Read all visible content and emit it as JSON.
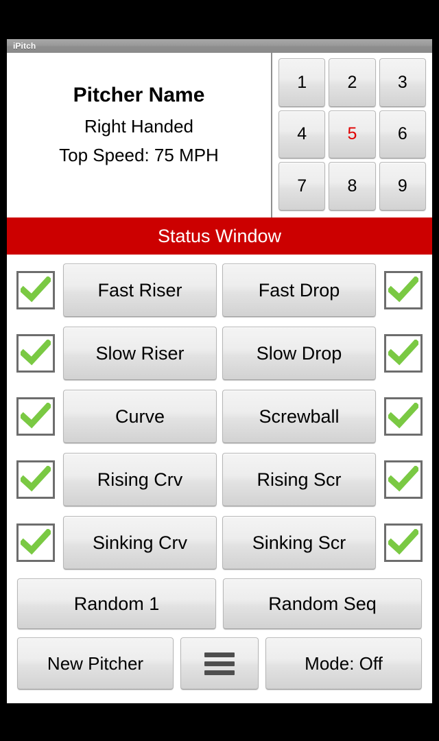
{
  "window": {
    "title": "iPitch"
  },
  "pitcher": {
    "name": "Pitcher Name",
    "handedness": "Right Handed",
    "top_speed": "Top Speed: 75 MPH"
  },
  "keypad": {
    "keys": [
      {
        "label": "1",
        "active": false
      },
      {
        "label": "2",
        "active": false
      },
      {
        "label": "3",
        "active": false
      },
      {
        "label": "4",
        "active": false
      },
      {
        "label": "5",
        "active": true
      },
      {
        "label": "6",
        "active": false
      },
      {
        "label": "7",
        "active": false
      },
      {
        "label": "8",
        "active": false
      },
      {
        "label": "9",
        "active": false
      }
    ],
    "selected": "5",
    "active_color": "#e00000"
  },
  "status": {
    "label": "Status Window",
    "bar_color": "#cc0000",
    "text_color": "#ffffff"
  },
  "pitches": {
    "check_color": "#7ac943",
    "rows": [
      {
        "left_checked": true,
        "left_label": "Fast Riser",
        "right_label": "Fast Drop",
        "right_checked": true
      },
      {
        "left_checked": true,
        "left_label": "Slow Riser",
        "right_label": "Slow Drop",
        "right_checked": true
      },
      {
        "left_checked": true,
        "left_label": "Curve",
        "right_label": "Screwball",
        "right_checked": true
      },
      {
        "left_checked": true,
        "left_label": "Rising Crv",
        "right_label": "Rising Scr",
        "right_checked": true
      },
      {
        "left_checked": true,
        "left_label": "Sinking Crv",
        "right_label": "Sinking Scr",
        "right_checked": true
      }
    ]
  },
  "random": {
    "single_label": "Random 1",
    "sequence_label": "Random Seq"
  },
  "bottom": {
    "new_pitcher_label": "New Pitcher",
    "menu_icon": "hamburger-menu-icon",
    "mode_label": "Mode: Off"
  }
}
